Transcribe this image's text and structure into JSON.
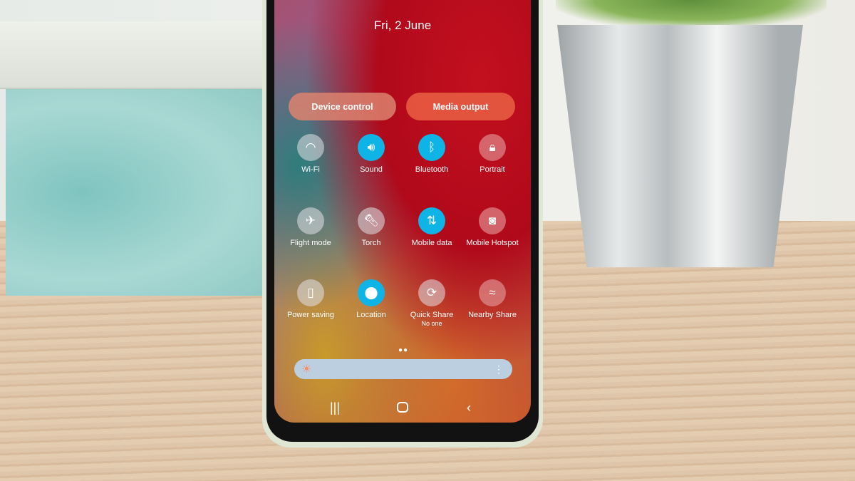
{
  "lockscreen": {
    "date": "Fri, 2 June"
  },
  "buttons": {
    "device_control": "Device control",
    "media_output": "Media output"
  },
  "tiles": [
    {
      "label": "Wi-Fi",
      "icon": "wifi-icon",
      "state": "off"
    },
    {
      "label": "Sound",
      "icon": "sound-icon",
      "state": "on"
    },
    {
      "label": "Bluetooth",
      "icon": "bluetooth-icon",
      "state": "on"
    },
    {
      "label": "Portrait",
      "icon": "portrait-lock-icon",
      "state": "off"
    },
    {
      "label": "Flight mode",
      "icon": "airplane-icon",
      "state": "off"
    },
    {
      "label": "Torch",
      "icon": "torch-icon",
      "state": "off"
    },
    {
      "label": "Mobile data",
      "icon": "mobile-data-icon",
      "state": "on"
    },
    {
      "label": "Mobile Hotspot",
      "icon": "hotspot-icon",
      "state": "off"
    },
    {
      "label": "Power saving",
      "icon": "power-saving-icon",
      "state": "off"
    },
    {
      "label": "Location",
      "icon": "location-icon",
      "state": "on"
    },
    {
      "label": "Quick Share",
      "sublabel": "No one",
      "icon": "quick-share-icon",
      "state": "off"
    },
    {
      "label": "Nearby Share",
      "icon": "nearby-share-icon",
      "state": "off"
    }
  ],
  "colors": {
    "active_tile": "#0fb4e6",
    "device_control": "#d8705c",
    "media_output": "#e0563f"
  }
}
